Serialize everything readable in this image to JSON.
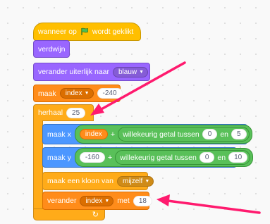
{
  "script": {
    "hat": {
      "text_before": "wanneer op",
      "flag_icon": "green-flag-icon",
      "text_after": "wordt geklikt"
    },
    "hide": {
      "label": "verdwijn"
    },
    "switch_costume": {
      "label": "verander uiterlijk naar",
      "value": "blauw"
    },
    "set_var": {
      "label": "maak",
      "variable": "index",
      "value": "-240"
    },
    "repeat": {
      "label": "herhaal",
      "count": "25"
    },
    "set_x": {
      "label": "maak x",
      "reporter": "index",
      "plus": "+",
      "random_label": "willekeurig getal tussen",
      "from": "0",
      "and": "en",
      "to": "5"
    },
    "set_y": {
      "label": "maak y",
      "value": "-160",
      "plus": "+",
      "random_label": "willekeurig getal tussen",
      "from": "0",
      "and": "en",
      "to": "10"
    },
    "clone": {
      "label": "maak een kloon van",
      "target": "mijzelf"
    },
    "change_var": {
      "label": "verander",
      "variable": "index",
      "by": "met",
      "value": "18"
    },
    "loop_arrow": "↻"
  },
  "colors": {
    "events": "#ffbf00",
    "looks": "#9966ff",
    "variables": "#ff8c1a",
    "control": "#ffab19",
    "motion": "#4c97ff",
    "operators": "#59c059",
    "arrow": "#ff1a6e"
  }
}
